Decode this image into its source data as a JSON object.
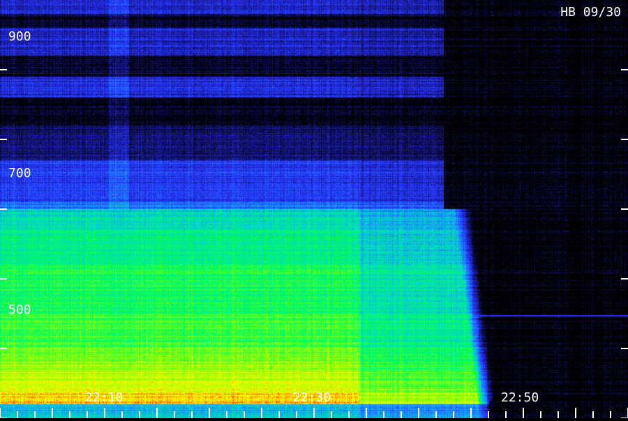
{
  "station_label": "HB 09/30",
  "chart_data": {
    "type": "heatmap",
    "title": "",
    "xlabel": "",
    "ylabel": "",
    "ylim": [
      400,
      1000
    ],
    "y_tick_labels": [
      "900",
      "700",
      "500"
    ],
    "y_tick_values": [
      900,
      800,
      700,
      600,
      500,
      400
    ],
    "x_tick_labels": [
      "22:10",
      "22:30",
      "22:50"
    ],
    "colormap": [
      "#000000",
      "#1a1a8c",
      "#2a3aff",
      "#1f8fff",
      "#00e0c0",
      "#00ff40",
      "#c8ff00",
      "#ffff00",
      "#ff2000"
    ],
    "grid": false
  }
}
